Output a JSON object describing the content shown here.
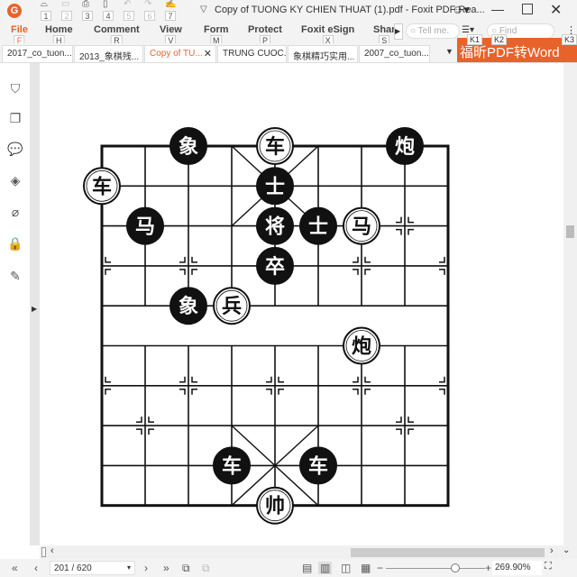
{
  "titlebar": {
    "title": "Copy of TUONG KY CHIEN THUAT (1).pdf - Foxit PDF Rea...",
    "quick_keys": [
      "1",
      "2",
      "3",
      "4",
      "5",
      "6",
      "7"
    ]
  },
  "menu": [
    {
      "label": "File",
      "key": "F"
    },
    {
      "label": "Home",
      "key": "H"
    },
    {
      "label": "Comment",
      "key": "R"
    },
    {
      "label": "View",
      "key": "V"
    },
    {
      "label": "Form",
      "key": "M"
    },
    {
      "label": "Protect",
      "key": "P"
    },
    {
      "label": "Foxit eSign",
      "key": "X"
    },
    {
      "label": "Shar",
      "key": "S"
    }
  ],
  "search": {
    "tell_placeholder": "Tell me.",
    "tell_key": "Q",
    "find_placeholder": "Find",
    "k1": "K1",
    "k2": "K2",
    "k3": "K3"
  },
  "tabs": [
    "2017_co_tuon...",
    "2013_象棋残...",
    "Copy of TU...",
    "TRUNG CUOC...",
    "象棋精巧实用...",
    "2007_co_tuon..."
  ],
  "active_tab": 2,
  "promo": "福昕PDF转Word",
  "accent": "#e8632b",
  "sidebar_icons": [
    "bookmark-icon",
    "pages-icon",
    "comment-icon",
    "layers-icon",
    "attachment-icon",
    "lock-icon",
    "signature-icon"
  ],
  "board": {
    "pieces": [
      {
        "char": "象",
        "side": "black",
        "col": 2,
        "row": 0
      },
      {
        "char": "车",
        "side": "red",
        "col": 4,
        "row": 0
      },
      {
        "char": "炮",
        "side": "black",
        "col": 7,
        "row": 0
      },
      {
        "char": "车",
        "side": "red",
        "col": 0,
        "row": 1
      },
      {
        "char": "士",
        "side": "black",
        "col": 4,
        "row": 1
      },
      {
        "char": "马",
        "side": "black",
        "col": 1,
        "row": 2
      },
      {
        "char": "将",
        "side": "black",
        "col": 4,
        "row": 2
      },
      {
        "char": "士",
        "side": "black",
        "col": 5,
        "row": 2
      },
      {
        "char": "马",
        "side": "red",
        "col": 6,
        "row": 2
      },
      {
        "char": "卒",
        "side": "black",
        "col": 4,
        "row": 3
      },
      {
        "char": "象",
        "side": "black",
        "col": 2,
        "row": 4
      },
      {
        "char": "兵",
        "side": "red",
        "col": 3,
        "row": 4
      },
      {
        "char": "炮",
        "side": "red",
        "col": 6,
        "row": 5
      },
      {
        "char": "车",
        "side": "black",
        "col": 3,
        "row": 8
      },
      {
        "char": "车",
        "side": "black",
        "col": 5,
        "row": 8
      },
      {
        "char": "帅",
        "side": "red",
        "col": 4,
        "row": 9
      }
    ]
  },
  "status": {
    "page": "201 / 620",
    "zoom": "269.90%",
    "zoom_slider_percent": 70
  }
}
